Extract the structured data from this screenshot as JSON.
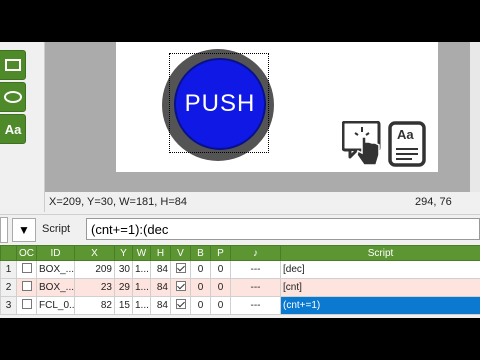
{
  "toolbox": {
    "tools": [
      {
        "name": "rectangle-tool",
        "icon": "rectangle-icon"
      },
      {
        "name": "ellipse-tool",
        "icon": "ellipse-icon"
      },
      {
        "name": "text-tool",
        "icon": "text-icon",
        "label": "Aa"
      }
    ]
  },
  "canvas": {
    "push_label": "PUSH",
    "doc_icon_label": "Aa",
    "icons": [
      "touch-hand-icon",
      "text-document-icon"
    ],
    "colors": {
      "push_fill": "#1018e6",
      "push_ring": "#545454",
      "background": "#ababab"
    }
  },
  "status": {
    "selection": "X=209, Y=30, W=181, H=84",
    "cursor": "294, 76"
  },
  "scriptbar": {
    "label": "Script",
    "value": "(cnt+=1):(dec"
  },
  "grid": {
    "columns": [
      "",
      "OC",
      "ID",
      "X",
      "Y",
      "W",
      "H",
      "V",
      "B",
      "P",
      "♪",
      "Script"
    ],
    "rows": [
      {
        "num": "1",
        "oc": false,
        "id": "BOX_...",
        "x": "209",
        "y": "30",
        "w": "1...",
        "h": "84",
        "v": true,
        "b": "0",
        "p": "0",
        "sound": "---",
        "script": "[dec]"
      },
      {
        "num": "2",
        "oc": false,
        "id": "BOX_...",
        "x": "23",
        "y": "29",
        "w": "1...",
        "h": "84",
        "v": true,
        "b": "0",
        "p": "0",
        "sound": "---",
        "script": "[cnt]"
      },
      {
        "num": "3",
        "oc": false,
        "id": "FCL_0...",
        "x": "82",
        "y": "15",
        "w": "1...",
        "h": "84",
        "v": true,
        "b": "0",
        "p": "0",
        "sound": "---",
        "script": "(cnt+=1)"
      }
    ],
    "colors": {
      "header": "#5c9633",
      "row2": "#fde4de",
      "selected": "#0b79d0"
    }
  }
}
